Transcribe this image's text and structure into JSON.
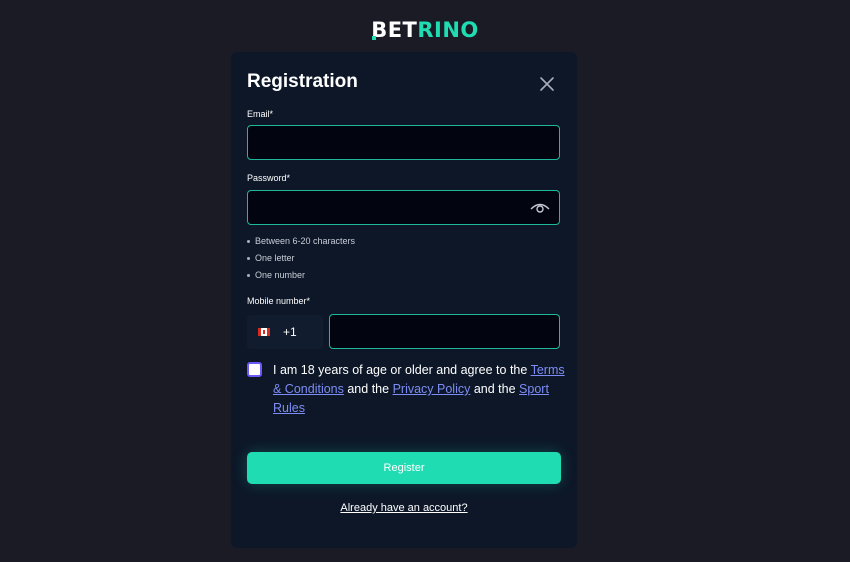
{
  "brand": {
    "bet": "BET",
    "rino": "RINO"
  },
  "modal": {
    "title": "Registration",
    "email_label": "Email*",
    "email_value": "",
    "password_label": "Password*",
    "password_value": "",
    "password_rules": [
      "Between 6-20 characters",
      "One letter",
      "One number"
    ],
    "mobile_label": "Mobile number*",
    "country_code": "+1",
    "country_flag": "canada-flag-icon",
    "phone_value": "",
    "checked": false,
    "agree": {
      "text1": "I am 18 years of age or older and agree to the",
      "terms": "Terms & Conditions",
      "and1": "and the",
      "privacy": "Privacy Policy",
      "and2": "and the",
      "sport": "Sport Rules"
    },
    "register_button": "Register",
    "login_link": "Already have an account?"
  },
  "colors": {
    "accent": "#1fdcb2",
    "background": "#1a1b25",
    "card": "#0d1728",
    "link": "#7d8df5",
    "checkbox_border": "#6a5af9"
  }
}
